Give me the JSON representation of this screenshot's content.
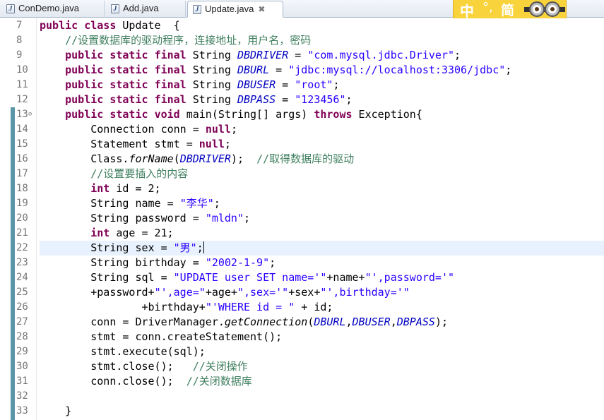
{
  "tabs": [
    {
      "label": "ConDemo.java",
      "active": false,
      "icon": "java-file-icon"
    },
    {
      "label": "Add.java",
      "active": false,
      "icon": "java-file-icon"
    },
    {
      "label": "Update.java",
      "active": true,
      "icon": "java-file-icon",
      "close_glyph": "✖"
    }
  ],
  "ime": {
    "mode": "中",
    "punct": "°,",
    "script": "简",
    "icon": "minion-face-icon"
  },
  "editor": {
    "current_line": 22,
    "caret_after": "String sex = \"男\";",
    "folded_line": 13,
    "fold_glyph": "⊖",
    "lines": [
      {
        "n": "7",
        "text": "public class Update  {"
      },
      {
        "n": "8",
        "text": "    //设置数据库的驱动程序，连接地址，用户名，密码"
      },
      {
        "n": "9",
        "text": "    public static final String DBDRIVER = \"com.mysql.jdbc.Driver\";"
      },
      {
        "n": "10",
        "text": "    public static final String DBURL = \"jdbc:mysql://localhost:3306/jdbc\";"
      },
      {
        "n": "11",
        "text": "    public static final String DBUSER = \"root\";"
      },
      {
        "n": "12",
        "text": "    public static final String DBPASS = \"123456\";"
      },
      {
        "n": "13",
        "text": "    public static void main(String[] args) throws Exception{"
      },
      {
        "n": "14",
        "text": "        Connection conn = null;"
      },
      {
        "n": "15",
        "text": "        Statement stmt = null;"
      },
      {
        "n": "16",
        "text": "        Class.forName(DBDRIVER);  //取得数据库的驱动"
      },
      {
        "n": "17",
        "text": "        //设置要插入的内容"
      },
      {
        "n": "18",
        "text": "        int id = 2;"
      },
      {
        "n": "19",
        "text": "        String name = \"李华\";"
      },
      {
        "n": "20",
        "text": "        String password = \"mldn\";"
      },
      {
        "n": "21",
        "text": "        int age = 21;"
      },
      {
        "n": "22",
        "text": "        String sex = \"男\";"
      },
      {
        "n": "23",
        "text": "        String birthday = \"2002-1-9\";"
      },
      {
        "n": "24",
        "text": "        String sql = \"UPDATE user SET name='\"+name+\"',password='\""
      },
      {
        "n": "25",
        "text": "        +password+\"',age=\"+age+\",sex='\"+sex+\"',birthday='\""
      },
      {
        "n": "26",
        "text": "                +birthday+\"'WHERE id = \" + id;"
      },
      {
        "n": "27",
        "text": "        conn = DriverManager.getConnection(DBURL,DBUSER,DBPASS);"
      },
      {
        "n": "28",
        "text": "        stmt = conn.createStatement();"
      },
      {
        "n": "29",
        "text": "        stmt.execute(sql);"
      },
      {
        "n": "30",
        "text": "        stmt.close();   //关闭操作"
      },
      {
        "n": "31",
        "text": "        conn.close();  //关闭数据库"
      },
      {
        "n": "32",
        "text": ""
      },
      {
        "n": "33",
        "text": "    }"
      }
    ]
  },
  "colors": {
    "keyword": "#7f0055",
    "string": "#2a00ff",
    "comment": "#3f7f5f",
    "static_field": "#0000c0",
    "line_number": "#787878",
    "current_line": "#e8f2fe",
    "change_bar": "#5a95a8",
    "ime_bg": "#f9d33c"
  }
}
